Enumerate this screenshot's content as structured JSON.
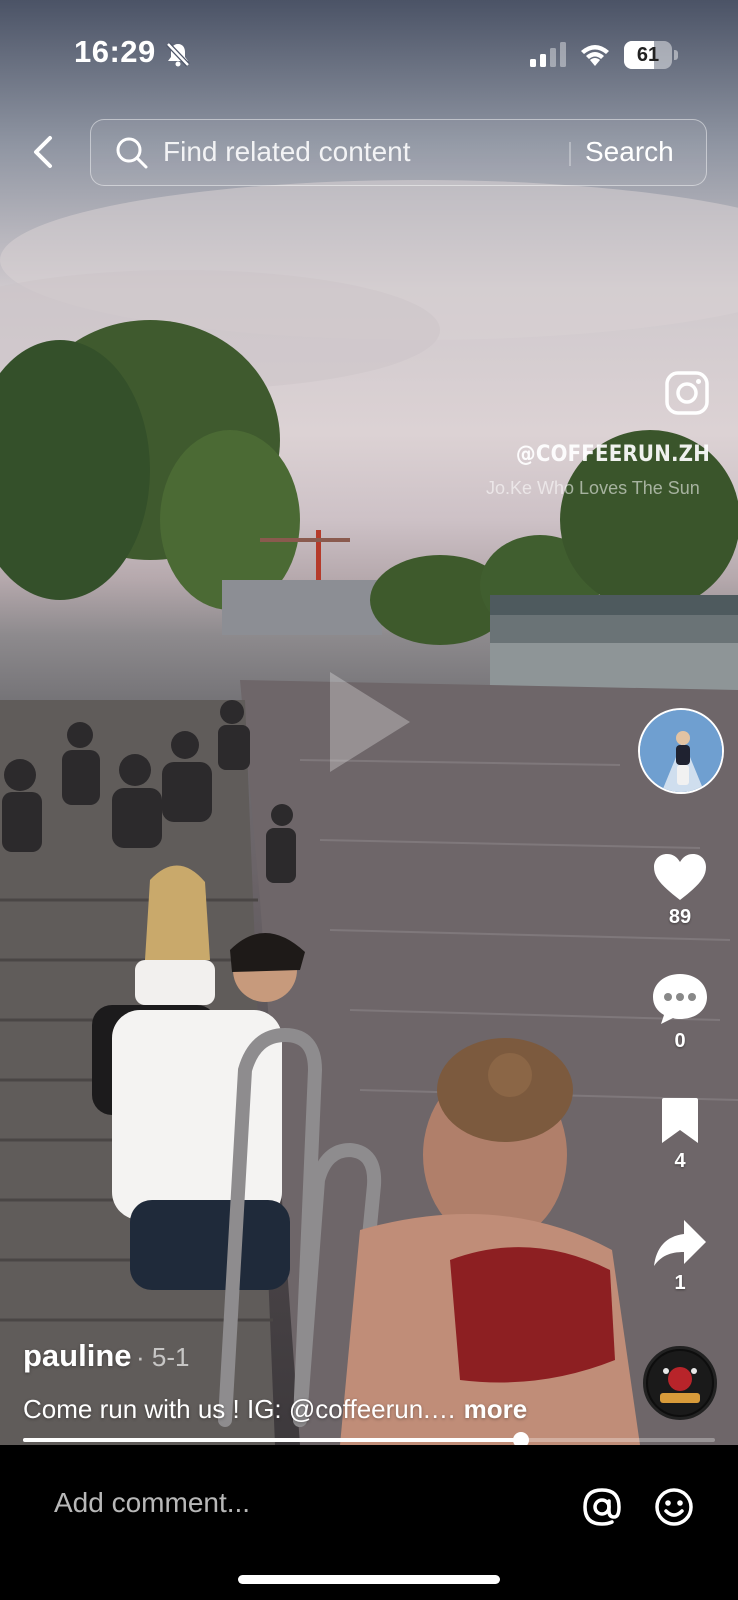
{
  "status_bar": {
    "time": "16:29",
    "battery_level": "61"
  },
  "top_bar": {
    "search_placeholder": "Find related content",
    "search_button": "Search"
  },
  "video": {
    "watermark": "@COFFEERUN.ZH",
    "music_credit": "Jo.Ke   Who Loves The Sun",
    "progress_fraction": 0.72
  },
  "actions": {
    "likes": "89",
    "comments": "0",
    "bookmarks": "4",
    "shares": "1"
  },
  "caption": {
    "author": "pauline",
    "date": "· 5-1",
    "text": "Come run with us ! IG: @coffeerun.…",
    "more_label": "more"
  },
  "comment_bar": {
    "placeholder": "Add comment..."
  },
  "colors": {
    "background": "#000000",
    "text": "#ffffff"
  }
}
